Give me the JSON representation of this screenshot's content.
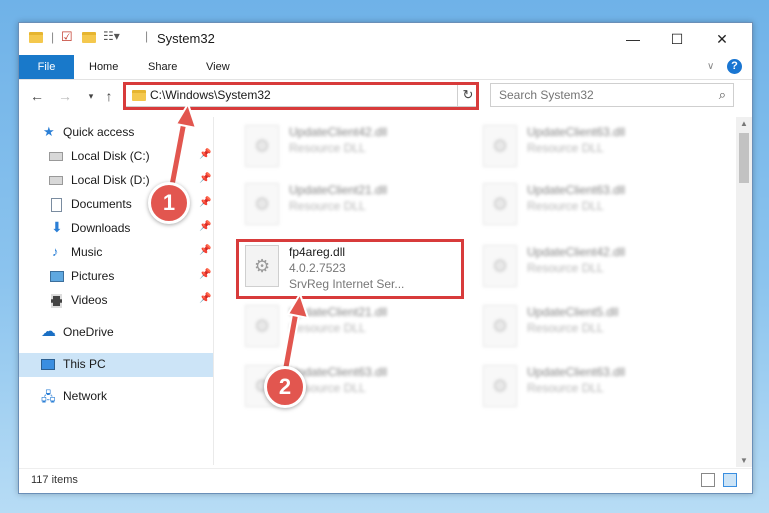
{
  "window": {
    "title": "System32",
    "controls": {
      "minimize": "—",
      "maximize": "☐",
      "close": "✕"
    }
  },
  "ribbon": {
    "file": "File",
    "tabs": [
      "Home",
      "Share",
      "View"
    ],
    "help": "?"
  },
  "address": {
    "path": "C:\\Windows\\System32",
    "search_placeholder": "Search System32"
  },
  "sidebar": {
    "items": [
      {
        "label": "Quick access",
        "icon": "star-icon",
        "pinned": false
      },
      {
        "label": "Local Disk (C:)",
        "icon": "drive-icon",
        "pinned": true
      },
      {
        "label": "Local Disk (D:)",
        "icon": "drive-icon",
        "pinned": true
      },
      {
        "label": "Documents",
        "icon": "documents-icon",
        "pinned": true
      },
      {
        "label": "Downloads",
        "icon": "download-icon",
        "pinned": true
      },
      {
        "label": "Music",
        "icon": "music-icon",
        "pinned": true
      },
      {
        "label": "Pictures",
        "icon": "pictures-icon",
        "pinned": true
      },
      {
        "label": "Videos",
        "icon": "videos-icon",
        "pinned": true
      },
      {
        "label": "OneDrive",
        "icon": "cloud-icon",
        "pinned": false
      },
      {
        "label": "This PC",
        "icon": "computer-icon",
        "pinned": false,
        "selected": true
      },
      {
        "label": "Network",
        "icon": "network-icon",
        "pinned": false
      }
    ]
  },
  "files": {
    "left": [
      {
        "name": "UpdateClient42.dll",
        "desc": "Resource DLL"
      },
      {
        "name": "UpdateClient21.dll",
        "desc": "Resource DLL"
      },
      {
        "name": "fp4areg.dll",
        "version": "4.0.2.7523",
        "desc": "SrvReg Internet Ser...",
        "highlighted": true
      },
      {
        "name": "UpdateClient21.dll",
        "desc": "Resource DLL"
      },
      {
        "name": "UpdateClient63.dll",
        "desc": "Resource DLL"
      }
    ],
    "right": [
      {
        "name": "UpdateClient63.dll",
        "desc": "Resource DLL"
      },
      {
        "name": "UpdateClient63.dll",
        "desc": "Resource DLL"
      },
      {
        "name": "UpdateClient42.dll",
        "desc": "Resource DLL"
      },
      {
        "name": "UpdateClient5.dll",
        "desc": "Resource DLL"
      },
      {
        "name": "UpdateClient63.dll",
        "desc": "Resource DLL"
      }
    ]
  },
  "status": {
    "count": "117 items"
  },
  "callouts": {
    "one": "1",
    "two": "2"
  },
  "colors": {
    "accent": "#1979ca",
    "highlight": "#d83b3b",
    "callout": "#e2564f"
  }
}
